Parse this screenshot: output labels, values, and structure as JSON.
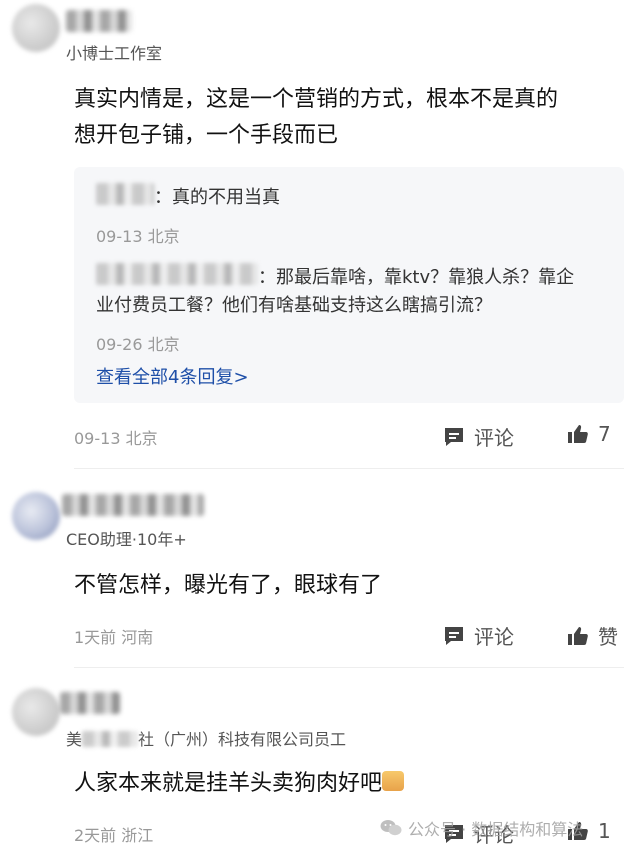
{
  "comments": [
    {
      "author_subtitle": "小博士工作室",
      "text_line1": "真实内情是，这是一个营销的方式，根本不是真的",
      "text_line2": "想开包子铺，一个手段而已",
      "replies": [
        {
          "text": "：真的不用当真",
          "meta": "09-13 北京"
        },
        {
          "text_line1": "：那最后靠啥，靠ktv？靠狼人杀？靠企",
          "text_line2": "业付费员工餐？他们有啥基础支持这么瞎搞引流？",
          "meta": "09-26 北京"
        }
      ],
      "view_all_replies": "查看全部4条回复>",
      "meta": "09-13 北京",
      "comment_label": "评论",
      "like_count": "7"
    },
    {
      "author_subtitle": "CEO助理·10年+",
      "text": "不管怎样，曝光有了，眼球有了",
      "meta": "1天前 河南",
      "comment_label": "评论",
      "like_label": "赞"
    },
    {
      "author_subtitle_prefix": "美",
      "author_subtitle": "社（广州）科技有限公司员工",
      "text": "人家本来就是挂羊头卖狗肉好吧",
      "meta": "2天前 浙江",
      "comment_label": "评论",
      "like_count": "1"
    }
  ],
  "watermark": "公众号 · 数据结构和算法",
  "icons": {
    "comment": "comment-bubble-icon",
    "like": "thumbs-up-icon",
    "wechat": "wechat-icon",
    "emoji": "smile-emoji-icon"
  },
  "colors": {
    "link": "#1e4fa8",
    "reply_bg": "#f6f7f9",
    "muted": "#999999"
  }
}
